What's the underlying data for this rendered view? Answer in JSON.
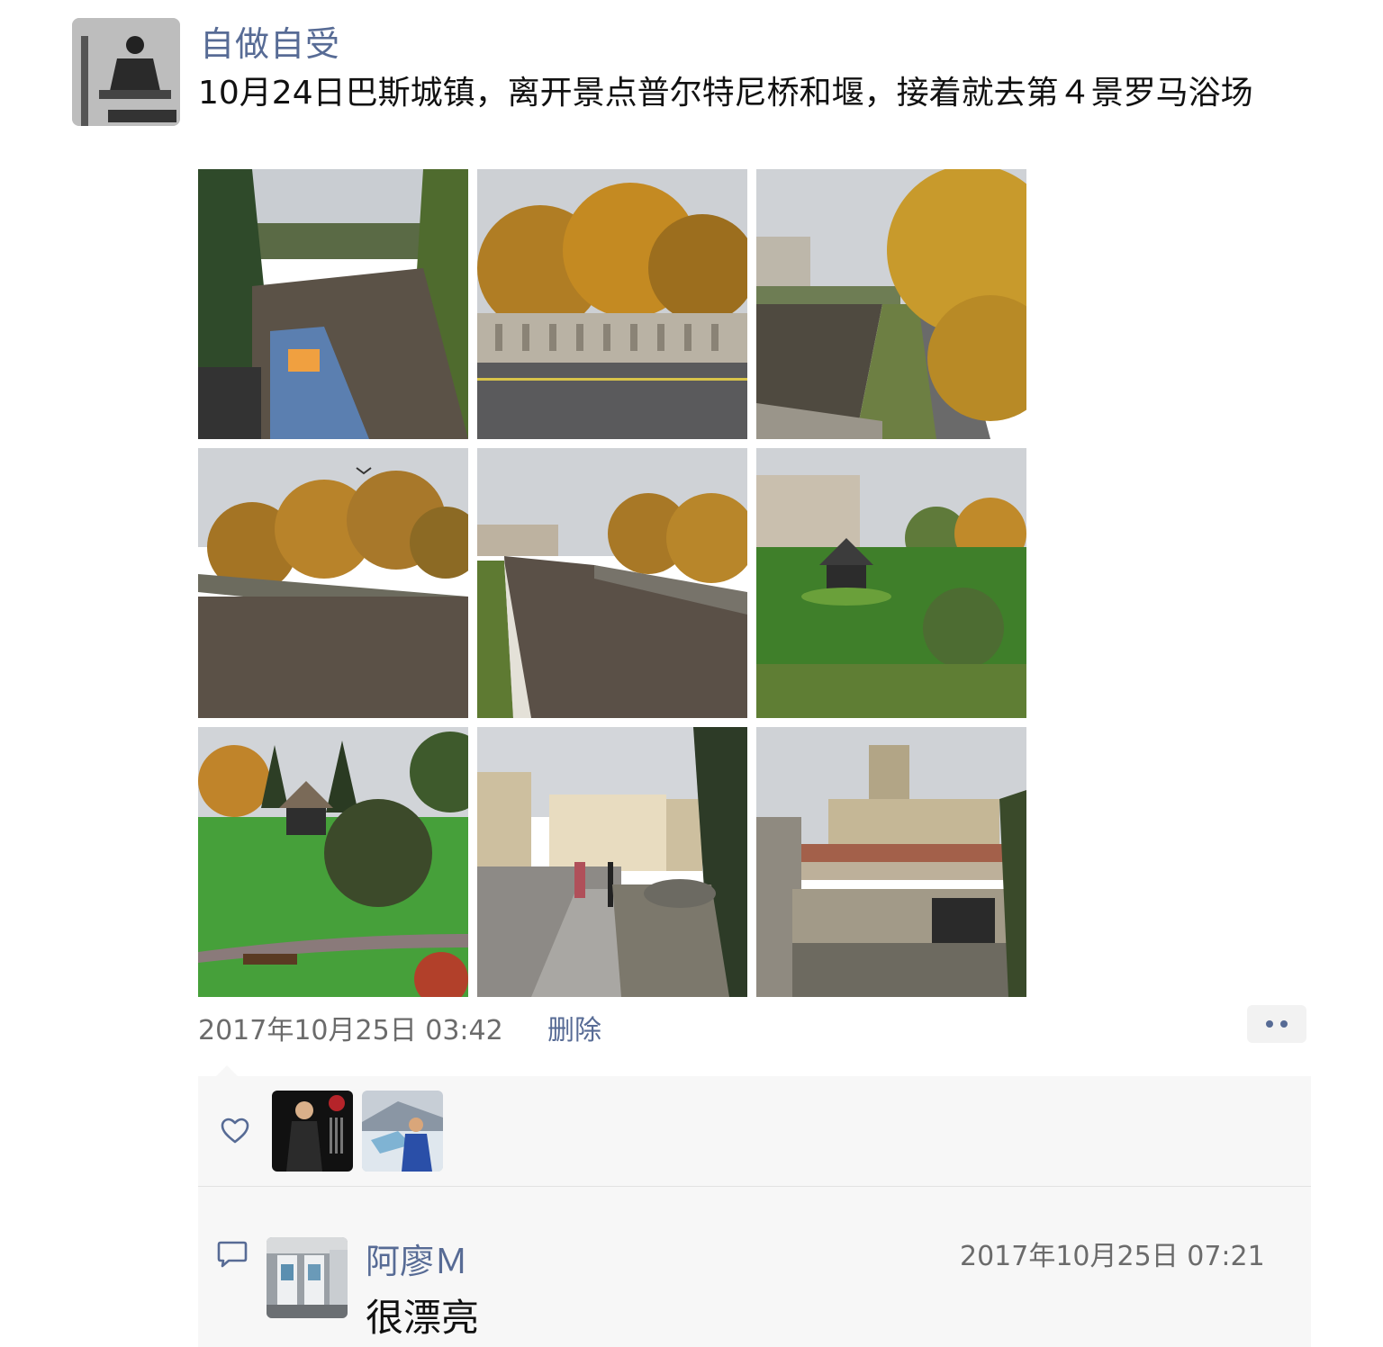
{
  "post": {
    "author": "自做自受",
    "text": "10月24日巴斯城镇，离开景点普尔特尼桥和堰，接着就去第４景罗马浴场",
    "timestamp": "2017年10月25日 03:42",
    "delete_label": "删除",
    "author_avatar_icon": "avatar-photo-icon",
    "photos": [
      {
        "icon": "river-boat-photo"
      },
      {
        "icon": "bridge-autumn-trees-photo"
      },
      {
        "icon": "river-walkway-photo"
      },
      {
        "icon": "river-bird-photo"
      },
      {
        "icon": "river-weir-photo"
      },
      {
        "icon": "park-bandstand-photo"
      },
      {
        "icon": "garden-gazebo-photo"
      },
      {
        "icon": "street-buildings-photo"
      },
      {
        "icon": "abbey-view-photo"
      }
    ]
  },
  "interactions": {
    "like_icon": "heart-icon",
    "likers": [
      {
        "icon": "liker-avatar-icon"
      },
      {
        "icon": "liker-avatar-icon"
      }
    ],
    "comments": [
      {
        "author": "阿廖Ｍ",
        "time": "2017年10月25日 07:21",
        "text": "很漂亮",
        "icon": "comment-icon"
      }
    ]
  },
  "colors": {
    "link": "#576b95",
    "meta": "#6b6b6b",
    "panel": "#f7f7f7"
  }
}
